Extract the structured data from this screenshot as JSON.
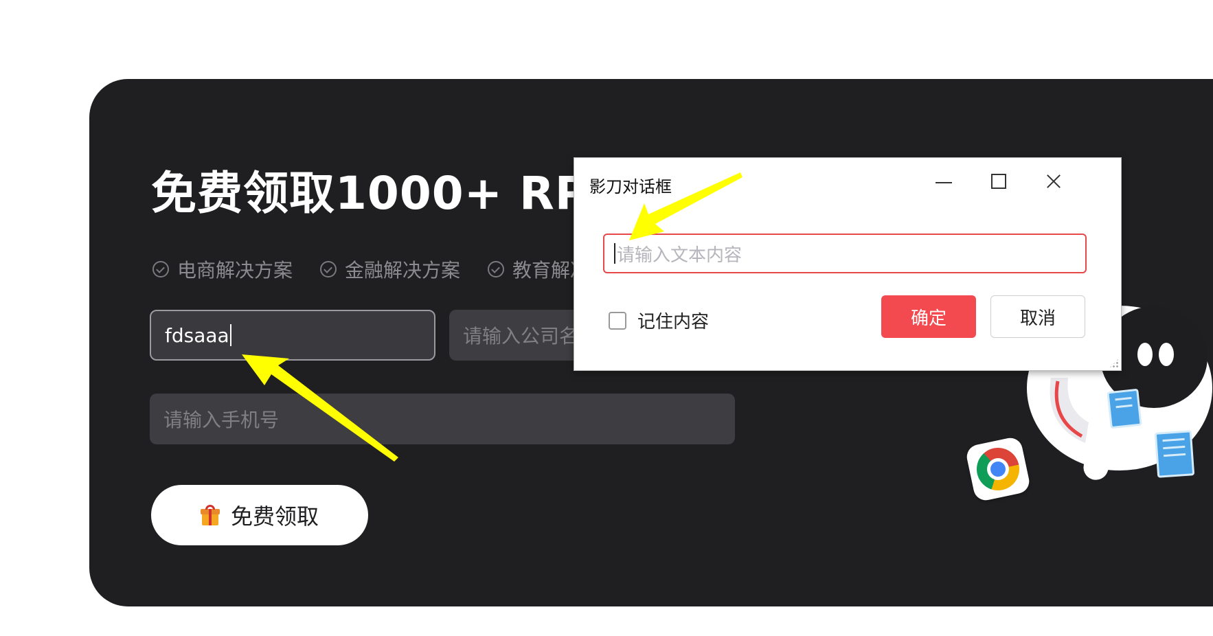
{
  "promo": {
    "headline": "免费领取1000+ RPA自",
    "features": [
      "电商解决方案",
      "金融解决方案",
      "教育解决方案"
    ],
    "name_value": "fdsaaa",
    "company_placeholder": "请输入公司名",
    "phone_placeholder": "请输入手机号",
    "claim_label": "免费领取"
  },
  "dialog": {
    "title": "影刀对话框",
    "input_placeholder": "请输入文本内容",
    "remember_label": "记住内容",
    "ok_label": "确定",
    "cancel_label": "取消"
  },
  "colors": {
    "panel_bg": "#1f1f21",
    "accent_red": "#f24a4f",
    "annotation_arrow": "#ffff00"
  }
}
